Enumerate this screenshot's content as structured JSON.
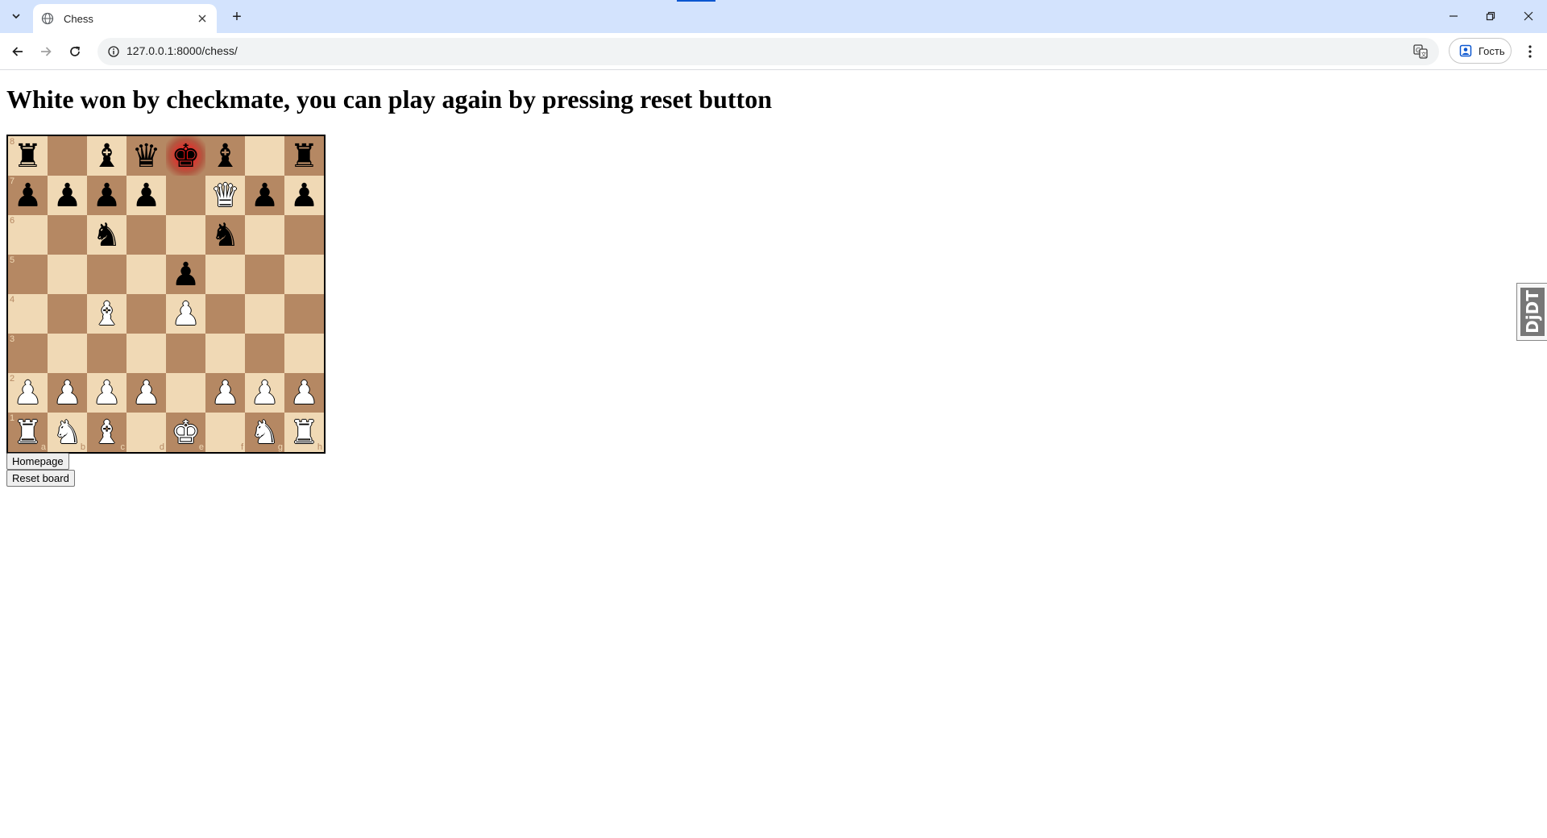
{
  "browser": {
    "tab_title": "Chess",
    "new_tab_label": "+",
    "url": "127.0.0.1:8000/chess/",
    "profile_label": "Гость",
    "accent_color": "#0b57d0",
    "tabstrip_color": "#d3e3fd"
  },
  "page": {
    "heading": "White won by checkmate, you can play again by pressing reset button",
    "homepage_button": "Homepage",
    "reset_button": "Reset board",
    "extension_badge": "DjDT"
  },
  "board": {
    "light_color": "#f0d9b5",
    "dark_color": "#b58863",
    "check_square": "e8",
    "ranks": [
      "8",
      "7",
      "6",
      "5",
      "4",
      "3",
      "2",
      "1"
    ],
    "files": [
      "a",
      "b",
      "c",
      "d",
      "e",
      "f",
      "g",
      "h"
    ],
    "position": [
      [
        "br",
        "",
        "bb",
        "bq",
        "bk",
        "bb",
        "",
        "br"
      ],
      [
        "bp",
        "bp",
        "bp",
        "bp",
        "",
        "wq",
        "bp",
        "bp"
      ],
      [
        "",
        "",
        "bn",
        "",
        "",
        "bn",
        "",
        ""
      ],
      [
        "",
        "",
        "",
        "",
        "bp",
        "",
        "",
        ""
      ],
      [
        "",
        "",
        "wb",
        "",
        "wp",
        "",
        "",
        ""
      ],
      [
        "",
        "",
        "",
        "",
        "",
        "",
        "",
        ""
      ],
      [
        "wp",
        "wp",
        "wp",
        "wp",
        "",
        "wp",
        "wp",
        "wp"
      ],
      [
        "wr",
        "wn",
        "wb",
        "",
        "wk",
        "",
        "wn",
        "wr"
      ]
    ]
  }
}
